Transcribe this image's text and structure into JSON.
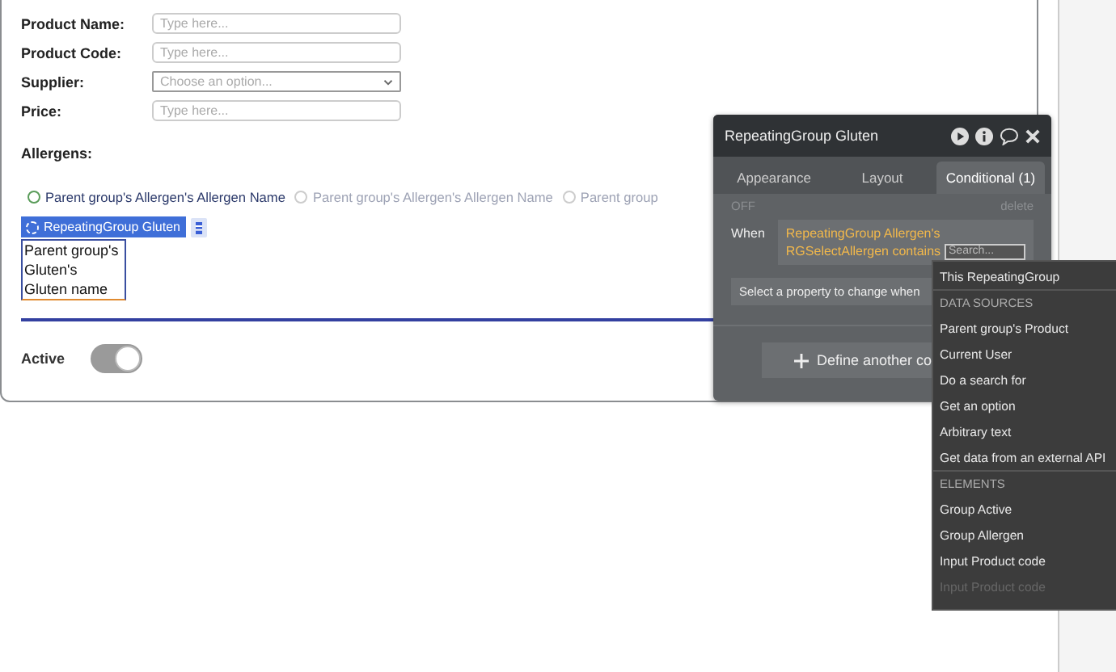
{
  "form": {
    "fields": [
      {
        "label": "Product Name:",
        "kind": "input",
        "placeholder": "Type here..."
      },
      {
        "label": "Product Code:",
        "kind": "input",
        "placeholder": "Type here..."
      },
      {
        "label": "Supplier:",
        "kind": "select",
        "placeholder": "Choose an option..."
      },
      {
        "label": "Price:",
        "kind": "input",
        "placeholder": "Type here..."
      }
    ],
    "allergens_label": "Allergens:",
    "radios": [
      {
        "label": "Parent group's Allergen's Allergen Name",
        "faded": false
      },
      {
        "label": "Parent group's Allergen's Allergen Name",
        "faded": true
      },
      {
        "label": "Parent group",
        "faded": true
      }
    ],
    "repeating_group_tag": "RepeatingGroup Gluten",
    "text_element": "Parent group's\nGluten's\nGluten name",
    "active_label": "Active",
    "active_toggle": {
      "on": true
    }
  },
  "editor": {
    "title": "RepeatingGroup Gluten",
    "tabs": [
      {
        "label": "Appearance",
        "selected": false
      },
      {
        "label": "Layout",
        "selected": false
      },
      {
        "label": "Conditional (1)",
        "selected": true
      }
    ],
    "condition": {
      "state": "OFF",
      "delete": "delete",
      "when": "When",
      "expression": "RepeatingGroup Allergen's RGSelectAllergen contains",
      "search_placeholder": "Search..."
    },
    "property_select": "Select a property to change when",
    "define_button": "Define another co"
  },
  "dropdown": {
    "items": [
      {
        "kind": "item",
        "label": "This RepeatingGroup"
      },
      {
        "kind": "header",
        "label": "DATA SOURCES"
      },
      {
        "kind": "item",
        "label": "Parent group's Product"
      },
      {
        "kind": "item",
        "label": "Current User"
      },
      {
        "kind": "item",
        "label": "Do a search for"
      },
      {
        "kind": "item",
        "label": "Get an option"
      },
      {
        "kind": "item",
        "label": "Arbitrary text"
      },
      {
        "kind": "item",
        "label": "Get data from an external API"
      },
      {
        "kind": "header",
        "label": "ELEMENTS"
      },
      {
        "kind": "item",
        "label": "Group Active"
      },
      {
        "kind": "item",
        "label": "Group Allergen"
      },
      {
        "kind": "item",
        "label": "Input Product code"
      },
      {
        "kind": "faded",
        "label": "Input Product code"
      }
    ]
  }
}
